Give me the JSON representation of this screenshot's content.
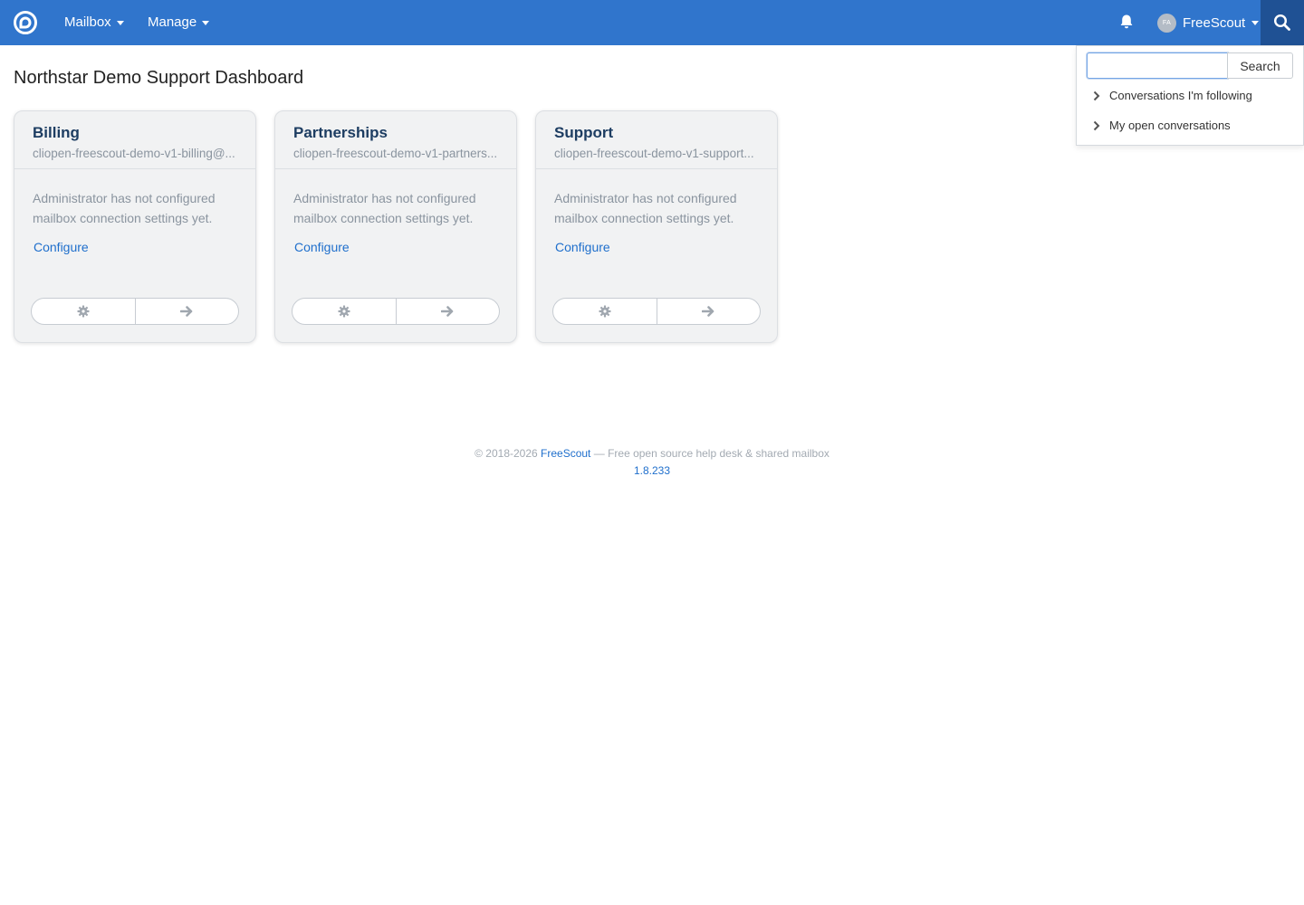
{
  "nav": {
    "mailbox_label": "Mailbox",
    "manage_label": "Manage",
    "user_initials": "FA",
    "user_name": "FreeScout"
  },
  "page": {
    "title": "Northstar Demo Support Dashboard"
  },
  "mailboxes": [
    {
      "name": "Billing",
      "email": "cliopen-freescout-demo-v1-billing@...",
      "message": "Administrator has not configured mailbox connection settings yet.",
      "link": "Configure"
    },
    {
      "name": "Partnerships",
      "email": "cliopen-freescout-demo-v1-partners...",
      "message": "Administrator has not configured mailbox connection settings yet.",
      "link": "Configure"
    },
    {
      "name": "Support",
      "email": "cliopen-freescout-demo-v1-support...",
      "message": "Administrator has not configured mailbox connection settings yet.",
      "link": "Configure"
    }
  ],
  "search_panel": {
    "input_value": "",
    "button_label": "Search",
    "items": [
      {
        "label": "Conversations I'm following"
      },
      {
        "label": "My open conversations"
      }
    ]
  },
  "footer": {
    "copyright": "© 2018-2026",
    "brand_link": "FreeScout",
    "tagline": "— Free open source help desk & shared mailbox",
    "version": "1.8.233"
  },
  "colors": {
    "navbar": "#3075cc",
    "search_toggle": "#1f5194",
    "link": "#1f6fcc"
  },
  "icons": [
    "freescout-logo-icon",
    "caret-down-icon",
    "bell-icon",
    "search-icon",
    "gear-icon",
    "arrow-right-icon",
    "chevron-right-icon"
  ]
}
